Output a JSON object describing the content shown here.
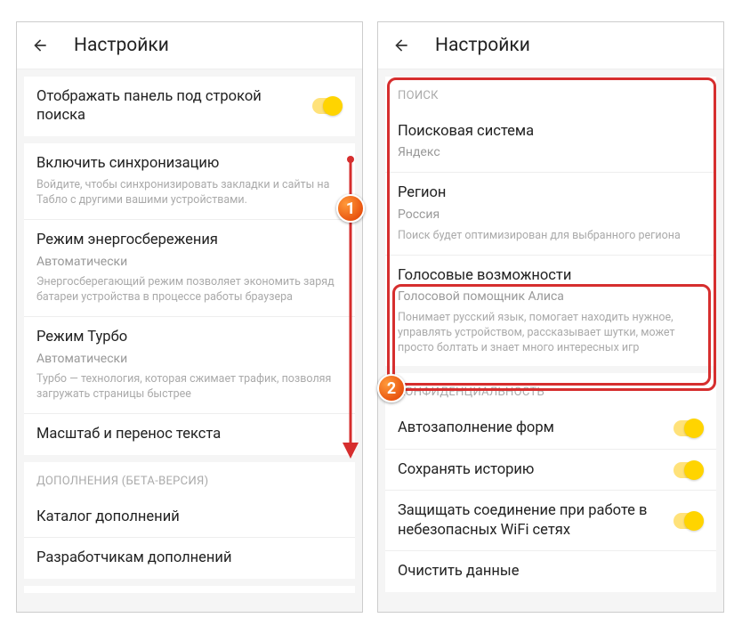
{
  "left": {
    "header": {
      "title": "Настройки"
    },
    "panel_toggle": {
      "title": "Отображать панель под строкой поиска"
    },
    "sync": {
      "title": "Включить синхронизацию",
      "note": "Войдите, чтобы синхронизировать закладки и сайты на Табло с другими вашими устройствами."
    },
    "power": {
      "title": "Режим энергосбережения",
      "sub": "Автоматически",
      "note": "Энергосберегающий режим позволяет экономить заряд батареи устройства в процессе работы браузера"
    },
    "turbo": {
      "title": "Режим Турбо",
      "sub": "Автоматически",
      "note": "Турбо — технология, которая сжимает трафик, позволяя загружать страницы быстрее"
    },
    "scale": {
      "title": "Масштаб и перенос текста"
    },
    "addons_header": "ДОПОЛНЕНИЯ (БЕТА-ВЕРСИЯ)",
    "addons_catalog": {
      "title": "Каталог дополнений"
    },
    "addons_dev": {
      "title": "Разработчикам дополнений"
    }
  },
  "right": {
    "header": {
      "title": "Настройки"
    },
    "search_header": "ПОИСК",
    "engine": {
      "title": "Поисковая система",
      "sub": "Яндекс"
    },
    "region": {
      "title": "Регион",
      "sub": "Россия",
      "note": "Поиск будет оптимизирован для выбранного региона"
    },
    "voice": {
      "title": "Голосовые возможности",
      "sub": "Голосовой помощник Алиса",
      "note": "Понимает русский язык, помогает находить нужное, управлять устройством, рассказывает шутки, может просто болтать и знает много интересных игр"
    },
    "privacy_header": "КОНФИДЕНЦИАЛЬНОСТЬ",
    "autofill": {
      "title": "Автозаполнение форм"
    },
    "history": {
      "title": "Сохранять историю"
    },
    "wifi": {
      "title": "Защищать соединение при работе в небезопасных WiFi сетях"
    },
    "clear": {
      "title": "Очистить данные"
    }
  },
  "markers": {
    "one": "1",
    "two": "2"
  }
}
